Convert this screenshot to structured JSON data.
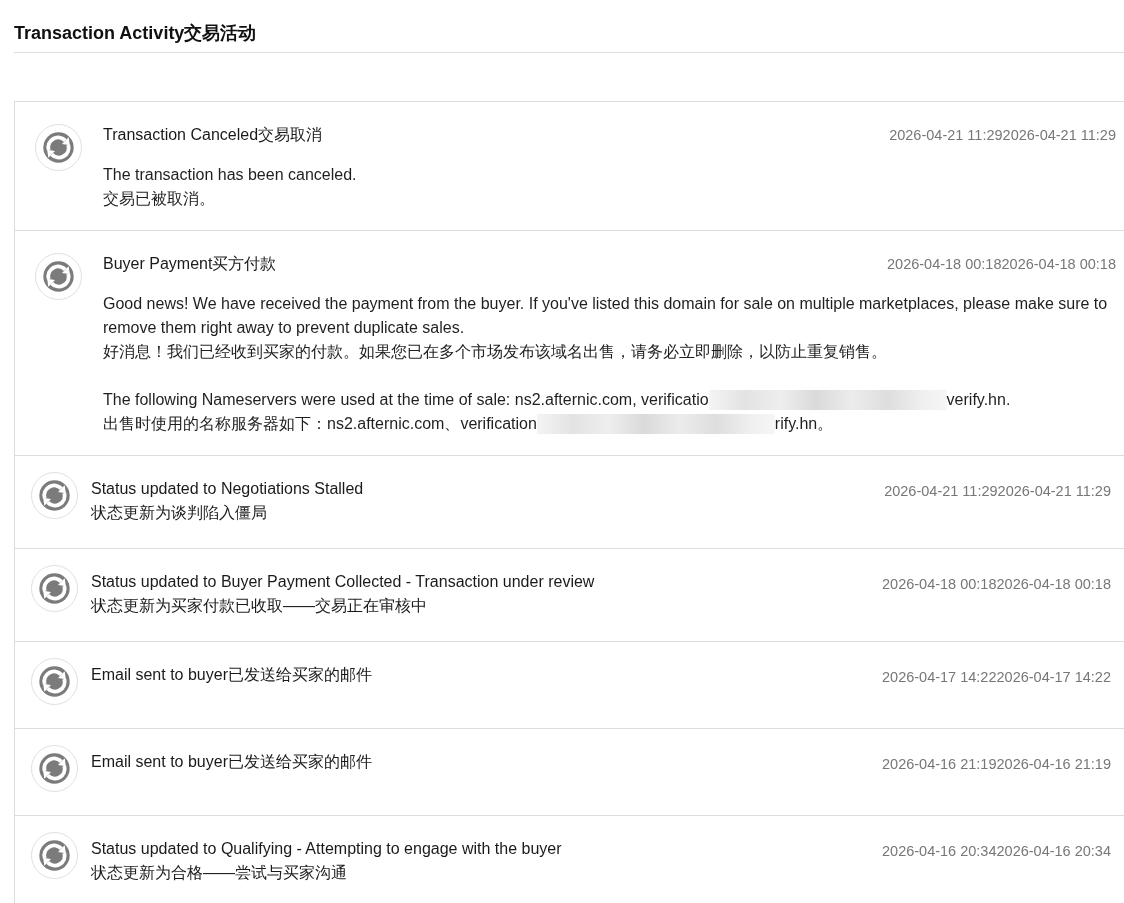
{
  "title": "Transaction Activity交易活动",
  "activities": [
    {
      "kind": "message",
      "title": "Transaction Canceled交易取消",
      "time": "2026-04-21 11:292026-04-21 11:29",
      "paragraphs": [
        {
          "lines": [
            [
              {
                "kind": "text",
                "text": "The transaction has been canceled."
              }
            ],
            [
              {
                "kind": "text",
                "text": "交易已被取消。"
              }
            ]
          ]
        }
      ]
    },
    {
      "kind": "message",
      "title": "Buyer Payment买方付款",
      "time": "2026-04-18 00:182026-04-18 00:18",
      "paragraphs": [
        {
          "lines": [
            [
              {
                "kind": "text",
                "text": "Good news! We have received the payment from the buyer. If you've listed this domain for sale on multiple marketplaces, please make sure to remove them right away to prevent duplicate sales."
              }
            ],
            [
              {
                "kind": "text",
                "text": "好消息！我们已经收到买家的付款。如果您已在多个市场发布该域名出售，请务必立即删除，以防止重复销售。"
              }
            ]
          ]
        },
        {
          "lines": [
            [
              {
                "kind": "text",
                "text": "The following Nameservers were used at the time of sale: ns2.afternic.com, verificatio"
              },
              {
                "kind": "redacted"
              },
              {
                "kind": "text",
                "text": "verify.hn."
              }
            ],
            [
              {
                "kind": "text",
                "text": "出售时使用的名称服务器如下：ns2.afternic.com、verification"
              },
              {
                "kind": "redacted"
              },
              {
                "kind": "text",
                "text": "rify.hn。"
              }
            ]
          ]
        }
      ]
    },
    {
      "kind": "status",
      "title": "Status updated to Negotiations Stalled",
      "subtitle": "状态更新为谈判陷入僵局",
      "time": "2026-04-21 11:292026-04-21 11:29"
    },
    {
      "kind": "status",
      "title": "Status updated to Buyer Payment Collected - Transaction under review",
      "subtitle": "状态更新为买家付款已收取——交易正在审核中",
      "time": "2026-04-18 00:182026-04-18 00:18"
    },
    {
      "kind": "status",
      "title": "Email sent to buyer已发送给买家的邮件",
      "time": "2026-04-17 14:222026-04-17 14:22"
    },
    {
      "kind": "status",
      "title": "Email sent to buyer已发送给买家的邮件",
      "time": "2026-04-16 21:192026-04-16 21:19"
    },
    {
      "kind": "status",
      "title": "Status updated to Qualifying - Attempting to engage with the buyer",
      "subtitle": "状态更新为合格——尝试与买家沟通",
      "time": "2026-04-16 20:342026-04-16 20:34"
    }
  ]
}
